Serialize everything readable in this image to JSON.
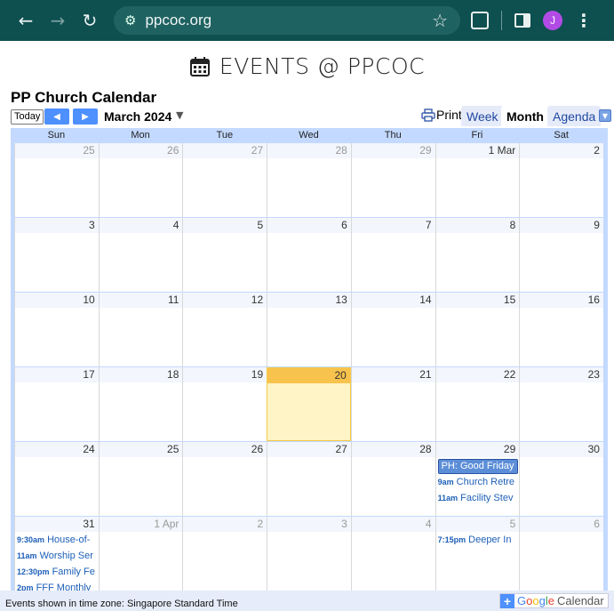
{
  "browser": {
    "url": "ppcoc.org",
    "avatar_letter": "J"
  },
  "page": {
    "title": "EVENTS @ PPCOC",
    "calendar_title": "PP Church Calendar"
  },
  "toolbar": {
    "today_label": "Today",
    "month_label": "March 2024",
    "print_label": "Print",
    "tabs": [
      {
        "label": "Week",
        "active": false
      },
      {
        "label": "Month",
        "active": true
      },
      {
        "label": "Agenda",
        "active": false
      }
    ]
  },
  "days_of_week": [
    "Sun",
    "Mon",
    "Tue",
    "Wed",
    "Thu",
    "Fri",
    "Sat"
  ],
  "weeks": [
    {
      "days": [
        {
          "num": "25",
          "other": true
        },
        {
          "num": "26",
          "other": true
        },
        {
          "num": "27",
          "other": true
        },
        {
          "num": "28",
          "other": true
        },
        {
          "num": "29",
          "other": true
        },
        {
          "num": "1 Mar"
        },
        {
          "num": "2"
        }
      ]
    },
    {
      "days": [
        {
          "num": "3"
        },
        {
          "num": "4"
        },
        {
          "num": "5"
        },
        {
          "num": "6"
        },
        {
          "num": "7"
        },
        {
          "num": "8"
        },
        {
          "num": "9"
        }
      ]
    },
    {
      "days": [
        {
          "num": "10"
        },
        {
          "num": "11"
        },
        {
          "num": "12"
        },
        {
          "num": "13"
        },
        {
          "num": "14"
        },
        {
          "num": "15"
        },
        {
          "num": "16"
        }
      ]
    },
    {
      "days": [
        {
          "num": "17"
        },
        {
          "num": "18"
        },
        {
          "num": "19"
        },
        {
          "num": "20",
          "today": true
        },
        {
          "num": "21"
        },
        {
          "num": "22"
        },
        {
          "num": "23"
        }
      ]
    },
    {
      "days": [
        {
          "num": "24"
        },
        {
          "num": "25"
        },
        {
          "num": "26"
        },
        {
          "num": "27"
        },
        {
          "num": "28"
        },
        {
          "num": "29",
          "allday": "PH: Good Friday",
          "events": [
            {
              "time": "9am",
              "title": "Church Retre"
            },
            {
              "time": "11am",
              "title": "Facility Stev"
            }
          ]
        },
        {
          "num": "30"
        }
      ]
    },
    {
      "days": [
        {
          "num": "31",
          "events": [
            {
              "time": "9:30am",
              "title": "House-of-"
            },
            {
              "time": "11am",
              "title": "Worship Ser"
            },
            {
              "time": "12:30pm",
              "title": "Family Fe"
            },
            {
              "time": "2pm",
              "title": "FFF Monthly"
            }
          ]
        },
        {
          "num": "1 Apr",
          "other": true
        },
        {
          "num": "2",
          "other": true
        },
        {
          "num": "3",
          "other": true
        },
        {
          "num": "4",
          "other": true
        },
        {
          "num": "5",
          "other": true,
          "events": [
            {
              "time": "7:15pm",
              "title": "Deeper In"
            }
          ]
        },
        {
          "num": "6",
          "other": true
        }
      ]
    }
  ],
  "footer": {
    "timezone_note": "Events shown in time zone: Singapore Standard Time",
    "gcal_google": "Google",
    "gcal_calendar": "Calendar"
  },
  "colors": {
    "chrome_bg": "#0e4f4f",
    "grid_border": "#c3d9ff",
    "today_bg": "#fff4c5",
    "event_text": "#1d5fb8"
  }
}
